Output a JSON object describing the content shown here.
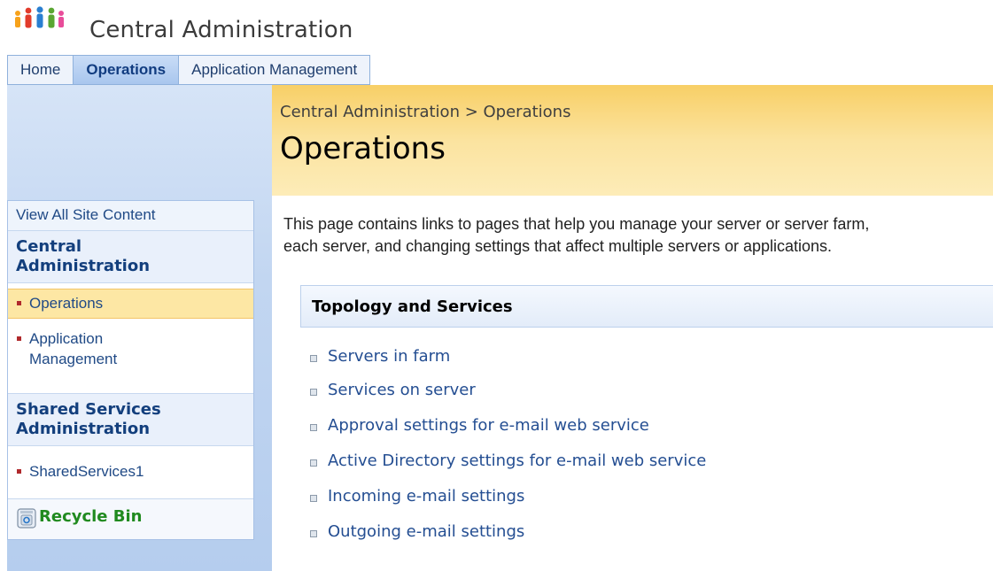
{
  "header": {
    "site_title": "Central Administration"
  },
  "tabs": [
    {
      "label": "Home",
      "active": false
    },
    {
      "label": "Operations",
      "active": true
    },
    {
      "label": "Application Management",
      "active": false
    }
  ],
  "breadcrumb": {
    "root": "Central Administration",
    "separator": " > ",
    "current": "Operations"
  },
  "page": {
    "title": "Operations",
    "description_line1": "This page contains links to pages that help you manage your server or server farm,",
    "description_line2": "each server, and changing settings that affect multiple servers or applications."
  },
  "left_nav": {
    "view_all": "View All Site Content",
    "group1_head_line1": "Central",
    "group1_head_line2": "Administration",
    "group1_items": [
      {
        "label": "Operations",
        "selected": true
      },
      {
        "label_line1": "Application",
        "label_line2": "Management",
        "selected": false
      }
    ],
    "group2_head_line1": "Shared Services",
    "group2_head_line2": "Administration",
    "group2_items": [
      {
        "label": "SharedServices1",
        "selected": false
      }
    ],
    "recycle_bin": "Recycle Bin"
  },
  "section": {
    "title": "Topology and Services",
    "links": [
      "Servers in farm",
      "Services on server",
      "Approval settings for e-mail web service",
      "Active Directory settings for e-mail web service",
      "Incoming e-mail settings",
      "Outgoing e-mail settings"
    ]
  },
  "colors": {
    "accent_blue": "#204a86",
    "title_band": "#f8cf66",
    "selected_nav": "#fde7a4",
    "recycle_green": "#208a1f"
  }
}
